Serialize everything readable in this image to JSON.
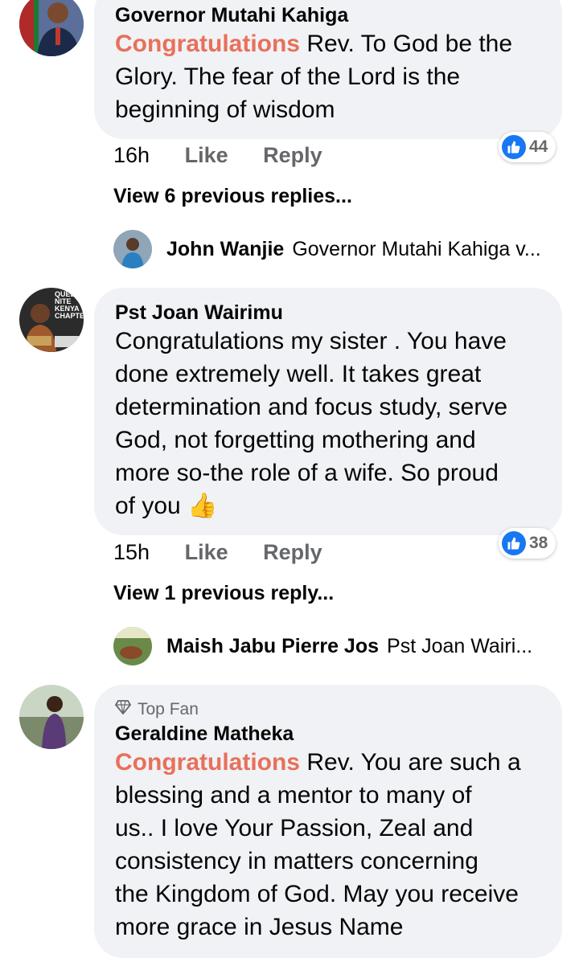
{
  "comments": [
    {
      "author": "Governor Mutahi Kahiga",
      "highlight": "Congratulations",
      "text_lines": [
        " Rev. To God be the",
        "Glory. The fear of the Lord is the",
        "beginning of wisdom"
      ],
      "time": "16h",
      "like_label": "Like",
      "reply_label": "Reply",
      "reactions": "44",
      "view_previous": "View 6 previous replies...",
      "latest_reply": {
        "name": "John Wanjie",
        "text": "Governor Mutahi Kahiga v..."
      }
    },
    {
      "author": "Pst Joan Wairimu",
      "text_lines": [
        "Congratulations my sister . You have",
        "done extremely well. It takes great",
        "determination and focus study, serve",
        "God, not forgetting mothering  and",
        "more so-the role of a wife. So proud",
        "of you  👍"
      ],
      "avatar_text": [
        "QUEEN",
        "NITE",
        "KENYA",
        "CHAPTER"
      ],
      "time": "15h",
      "like_label": "Like",
      "reply_label": "Reply",
      "reactions": "38",
      "view_previous": "View 1 previous reply...",
      "latest_reply": {
        "name": "Maish Jabu Pierre Jos",
        "text": "Pst Joan Wairi..."
      }
    },
    {
      "badge": "Top Fan",
      "author": "Geraldine Matheka",
      "highlight": "Congratulations",
      "text_lines": [
        " Rev. You are such a",
        "blessing and a mentor to many of",
        "us.. I love Your Passion, Zeal and",
        "consistency in matters concerning",
        "the Kingdom of God. May you receive",
        "more grace in Jesus Name"
      ]
    }
  ],
  "colors": {
    "highlight": "#e8705a",
    "like_blue": "#1877f2",
    "bubble": "#f0f2f5"
  }
}
